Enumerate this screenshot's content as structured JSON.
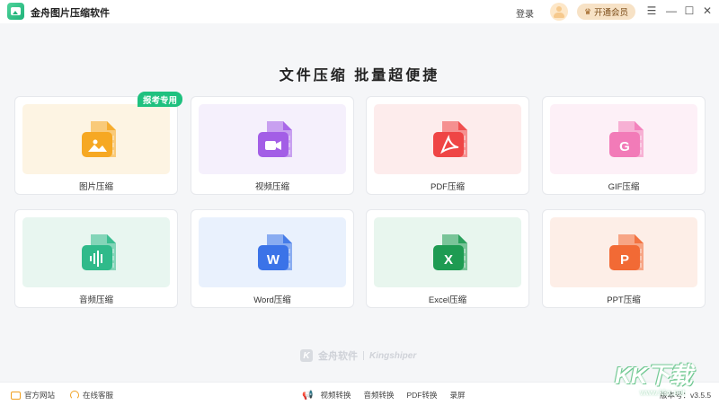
{
  "app": {
    "title": "金舟图片压缩软件",
    "login_label": "登录",
    "vip_label": "开通会员",
    "icons": [
      "app-logo",
      "avatar",
      "crown-icon",
      "menu-icon",
      "minimize-icon",
      "maximize-icon",
      "close-icon"
    ]
  },
  "main": {
    "headline": "文件压缩 批量超便捷",
    "badge": "报考专用",
    "cards": [
      {
        "label": "图片压缩",
        "icon": "image-file-icon",
        "color": "#f6a823",
        "bg": "#fdf4e3"
      },
      {
        "label": "视频压缩",
        "icon": "video-file-icon",
        "color": "#a35ee6",
        "bg": "#f5f0fc"
      },
      {
        "label": "PDF压缩",
        "icon": "pdf-file-icon",
        "color": "#ef4545",
        "bg": "#fdecec"
      },
      {
        "label": "GIF压缩",
        "icon": "gif-file-icon",
        "color": "#f27bb8",
        "bg": "#fdf0f7"
      },
      {
        "label": "音频压缩",
        "icon": "audio-file-icon",
        "color": "#2fba8a",
        "bg": "#e8f6f0"
      },
      {
        "label": "Word压缩",
        "icon": "word-file-icon",
        "color": "#3b73e8",
        "bg": "#e9f1fd"
      },
      {
        "label": "Excel压缩",
        "icon": "excel-file-icon",
        "color": "#1e9b52",
        "bg": "#e8f6ee"
      },
      {
        "label": "PPT压缩",
        "icon": "ppt-file-icon",
        "color": "#f26a35",
        "bg": "#fdeee7"
      }
    ]
  },
  "watermark": {
    "brand_cn": "金舟软件",
    "brand_en": "Kingshiper",
    "site": "KK下载",
    "site_url": "www.kkx.net"
  },
  "footer": {
    "official_site": "官方网站",
    "online_service": "在线客服",
    "links": [
      "视频转换",
      "音频转换",
      "PDF转换",
      "录屏"
    ],
    "version": "版本号：v3.5.5"
  }
}
